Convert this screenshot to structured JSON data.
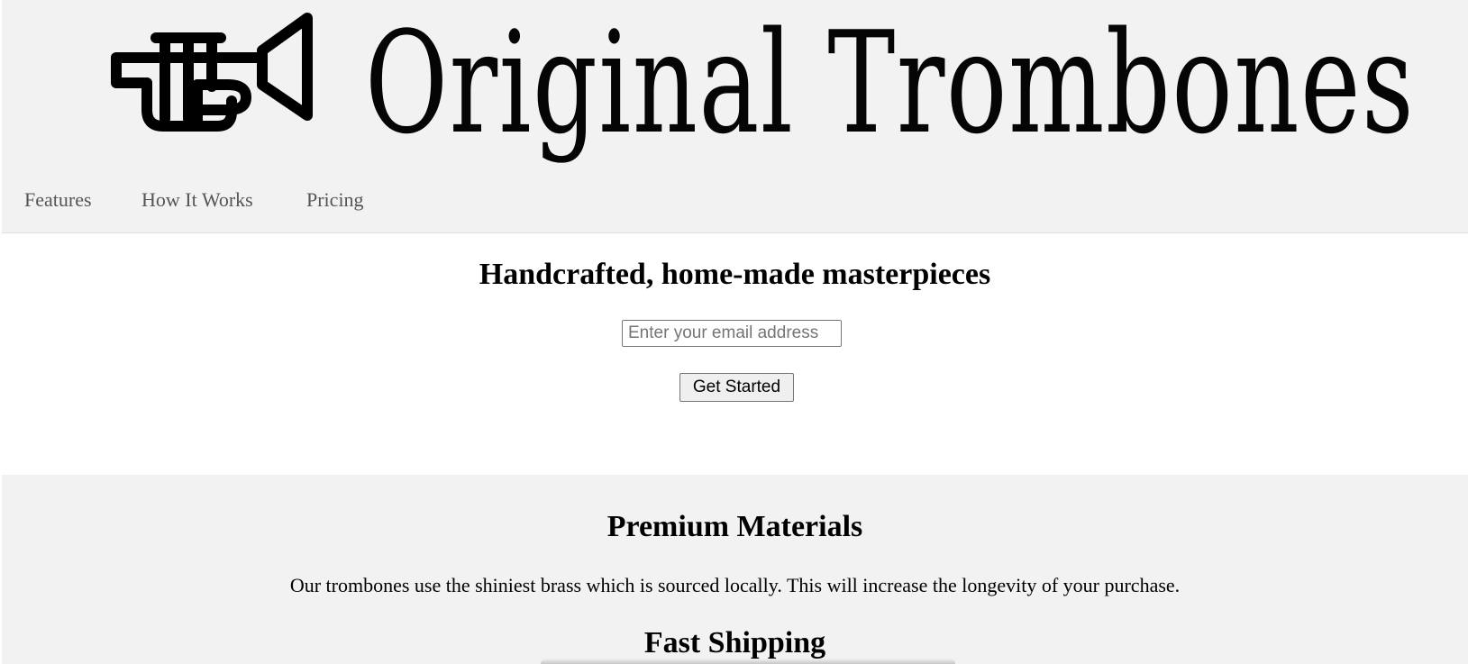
{
  "header": {
    "brand_name": "Original Trombones",
    "logo_icon": "trumpet-icon"
  },
  "nav": {
    "items": [
      {
        "label": "Features"
      },
      {
        "label": "How It Works"
      },
      {
        "label": "Pricing"
      }
    ]
  },
  "hero": {
    "title": "Handcrafted, home-made masterpieces",
    "email_placeholder": "Enter your email address",
    "email_value": "",
    "cta_label": "Get Started"
  },
  "features": {
    "items": [
      {
        "heading": "Premium Materials",
        "text": "Our trombones use the shiniest brass which is sourced locally. This will increase the longevity of your purchase."
      },
      {
        "heading": "Fast Shipping"
      }
    ]
  },
  "colors": {
    "header_bg": "#f2f2f2",
    "nav_text": "#555555",
    "body_bg": "#ffffff"
  }
}
